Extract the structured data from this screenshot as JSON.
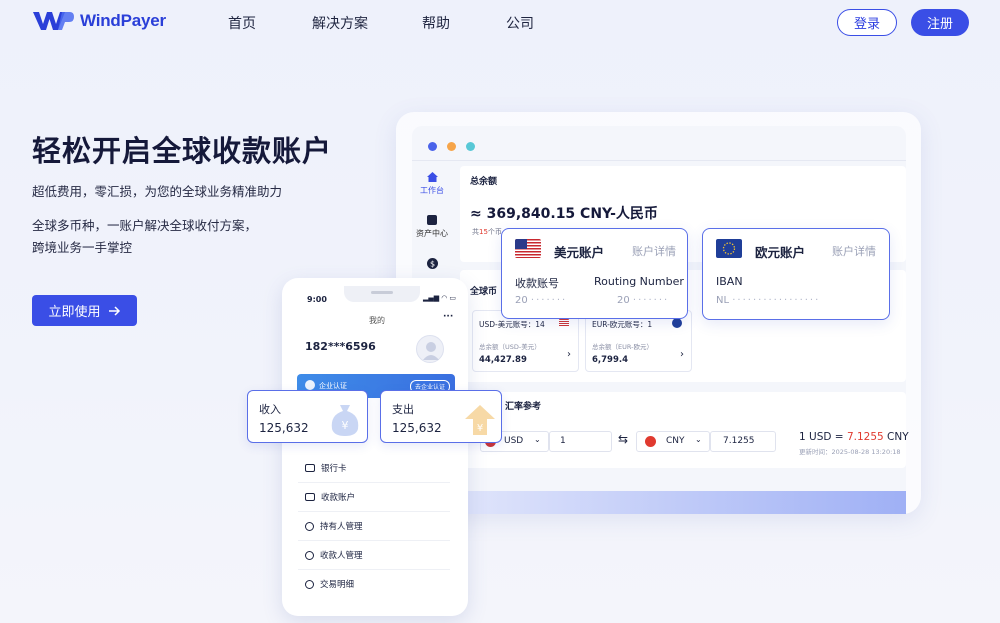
{
  "brand": {
    "name": "WindPayer",
    "logo_mark": "WP"
  },
  "nav": {
    "items": [
      "首页",
      "解决方案",
      "帮助",
      "公司"
    ],
    "login": "登录",
    "register": "注册"
  },
  "hero": {
    "title": "轻松开启全球收款账户",
    "line1": "超低费用，零汇损，为您的全球业务精准助力",
    "line2": "全球多币种，一账户解决全球收付方案，",
    "line3": "跨境业务一手掌控",
    "cta": "立即使用",
    "cta_icon": "arrow-right-icon"
  },
  "dashboard": {
    "sidebar": [
      {
        "label": "工作台",
        "icon": "home-icon"
      },
      {
        "label": "资产中心",
        "icon": "wallet-icon"
      },
      {
        "label": "",
        "icon": "dollar-icon"
      }
    ],
    "balance_title": "总余额",
    "balance_value": "≈ 369,840.15 CNY-人民币",
    "balance_note_prefix": "共",
    "balance_note_count": "15",
    "balance_note_suffix": "个币",
    "global_title": "全球币",
    "accounts": [
      {
        "title": "USD-美元账号：14",
        "sub": "总余额（USD-美元）",
        "amount": "44,427.89"
      },
      {
        "title": "EUR-欧元账号：1",
        "sub": "总余额（EUR-欧元）",
        "amount": "6,799.4"
      }
    ],
    "fx_title": "汇率参考",
    "fx": {
      "from_cur": "USD",
      "from_amt": "1",
      "to_cur": "CNY",
      "to_amt": "7.1255",
      "rate_prefix": "1 USD = ",
      "rate_value": "7.1255",
      "rate_suffix": " CNY",
      "updated": "更新时间：2025-08-28 13:20:18"
    }
  },
  "usd_card": {
    "title": "美元账户",
    "link": "账户详情",
    "col1_label": "收款账号",
    "col1_value": "20",
    "col2_label": "Routing Number",
    "col2_value": "20"
  },
  "eur_card": {
    "title": "欧元账户",
    "link": "账户详情",
    "col1_label": "IBAN",
    "col1_value": "NL"
  },
  "phone": {
    "time": "9:00",
    "page": "我的",
    "user": "182***6596",
    "more": "···",
    "banner_text": "企业认证",
    "banner_btn": "去企业认证",
    "menu": [
      {
        "label": "银行卡",
        "icon": "bank-card-icon"
      },
      {
        "label": "收款账户",
        "icon": "folder-icon"
      },
      {
        "label": "持有人管理",
        "icon": "person-icon"
      },
      {
        "label": "收款人管理",
        "icon": "people-icon"
      },
      {
        "label": "交易明细",
        "icon": "clock-icon"
      }
    ]
  },
  "income_card": {
    "label": "收入",
    "value": "125,632"
  },
  "expense_card": {
    "label": "支出",
    "value": "125,632"
  },
  "colors": {
    "primary": "#3a4ee6",
    "red": "#e03a2f"
  }
}
